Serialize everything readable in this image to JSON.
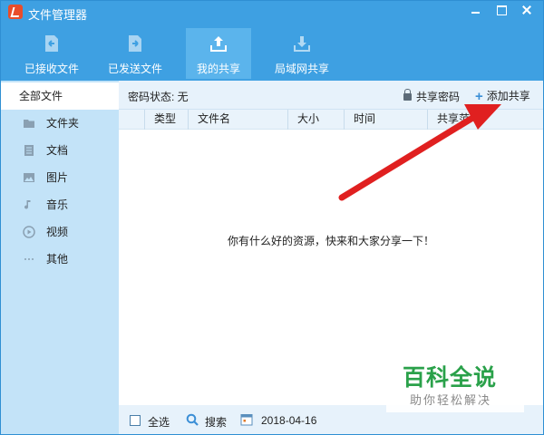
{
  "window": {
    "title": "文件管理器"
  },
  "toolbar": {
    "items": [
      {
        "label": "已接收文件",
        "icon": "received-files-icon"
      },
      {
        "label": "已发送文件",
        "icon": "sent-files-icon"
      },
      {
        "label": "我的共享",
        "icon": "upload-share-icon",
        "active": true
      },
      {
        "label": "局域网共享",
        "icon": "download-lan-icon"
      }
    ]
  },
  "sidebar": {
    "items": [
      {
        "label": "全部文件",
        "active": true
      },
      {
        "label": "文件夹",
        "icon": "folder-icon"
      },
      {
        "label": "文档",
        "icon": "document-icon"
      },
      {
        "label": "图片",
        "icon": "image-icon"
      },
      {
        "label": "音乐",
        "icon": "music-note-icon"
      },
      {
        "label": "视频",
        "icon": "video-play-icon"
      },
      {
        "label": "其他",
        "icon": "more-dots-icon"
      }
    ]
  },
  "main": {
    "password_status": "密码状态: 无",
    "share_password": "共享密码",
    "add_share": "添加共享",
    "columns": [
      "类型",
      "文件名",
      "大小",
      "时间",
      "共享范"
    ],
    "empty_message": "你有什么好的资源，快来和大家分享一下！"
  },
  "bottom": {
    "select_all": "全选",
    "search": "搜索",
    "date": "2018-04-16"
  },
  "watermark": {
    "title": "百科全说",
    "subtitle": "助你轻松解决"
  },
  "colors": {
    "titlebar": "#3ea0e2",
    "sidebar": "#c3e3f8",
    "annotation_arrow": "#e02020",
    "watermark_green": "#2aa14a"
  }
}
